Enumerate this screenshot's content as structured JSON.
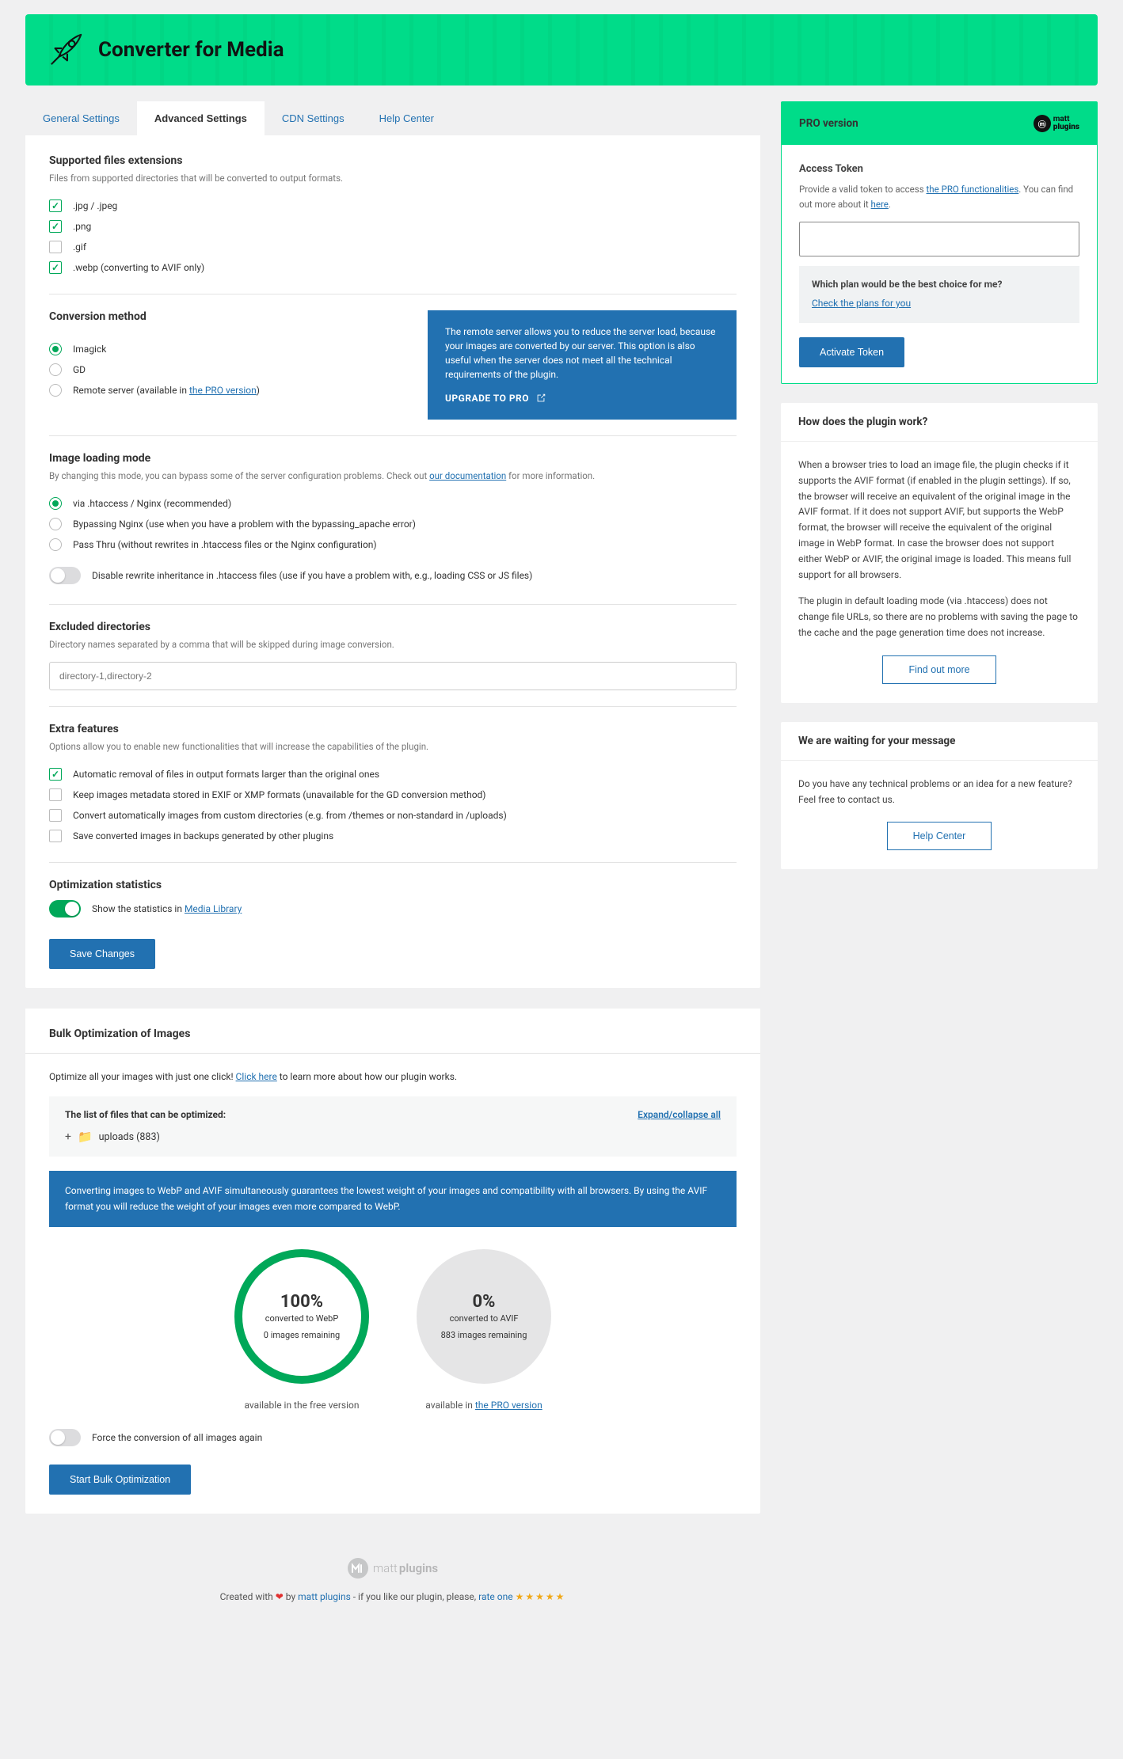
{
  "banner": {
    "title": "Converter for Media"
  },
  "tabs": [
    "General Settings",
    "Advanced Settings",
    "CDN Settings",
    "Help Center"
  ],
  "active_tab": 1,
  "supported": {
    "title": "Supported files extensions",
    "desc": "Files from supported directories that will be converted to output formats.",
    "items": [
      {
        "label": ".jpg / .jpeg",
        "checked": true
      },
      {
        "label": ".png",
        "checked": true
      },
      {
        "label": ".gif",
        "checked": false
      },
      {
        "label": ".webp (converting to AVIF only)",
        "checked": true
      }
    ]
  },
  "conversion": {
    "title": "Conversion method",
    "items": [
      {
        "label": "Imagick",
        "selected": true
      },
      {
        "label": "GD",
        "selected": false
      }
    ],
    "remote_prefix": "Remote server (available in ",
    "remote_link": "the PRO version",
    "remote_suffix": ")",
    "promo": "The remote server allows you to reduce the server load, because your images are converted by our server. This option is also useful when the server does not meet all the technical requirements of the plugin.",
    "promo_link": "UPGRADE TO PRO"
  },
  "loading": {
    "title": "Image loading mode",
    "desc_prefix": "By changing this mode, you can bypass some of the server configuration problems. Check out ",
    "desc_link": "our documentation",
    "desc_suffix": " for more information.",
    "items": [
      {
        "label": "via .htaccess / Nginx (recommended)",
        "selected": true
      },
      {
        "label": "Bypassing Nginx (use when you have a problem with the bypassing_apache error)",
        "selected": false
      },
      {
        "label": "Pass Thru (without rewrites in .htaccess files or the Nginx configuration)",
        "selected": false
      }
    ],
    "toggle_label": "Disable rewrite inheritance in .htaccess files (use if you have a problem with, e.g., loading CSS or JS files)",
    "toggle_on": false
  },
  "excluded": {
    "title": "Excluded directories",
    "desc": "Directory names separated by a comma that will be skipped during image conversion.",
    "placeholder": "directory-1,directory-2"
  },
  "extra": {
    "title": "Extra features",
    "desc": "Options allow you to enable new functionalities that will increase the capabilities of the plugin.",
    "items": [
      {
        "label": "Automatic removal of files in output formats larger than the original ones",
        "checked": true
      },
      {
        "label": "Keep images metadata stored in EXIF or XMP formats (unavailable for the GD conversion method)",
        "checked": false
      },
      {
        "label": "Convert automatically images from custom directories (e.g. from /themes or non-standard in /uploads)",
        "checked": false
      },
      {
        "label": "Save converted images in backups generated by other plugins",
        "checked": false
      }
    ]
  },
  "stats": {
    "title": "Optimization statistics",
    "label_prefix": "Show the statistics in ",
    "label_link": "Media Library",
    "on": true
  },
  "save_btn": "Save Changes",
  "bulk": {
    "title": "Bulk Optimization of Images",
    "desc_prefix": "Optimize all your images with just one click! ",
    "desc_link": "Click here",
    "desc_suffix": " to learn more about how our plugin works.",
    "tree_title": "The list of files that can be optimized:",
    "tree_expand": "Expand/collapse all",
    "tree_folder": "uploads (883)",
    "notice": "Converting images to WebP and AVIF simultaneously guarantees the lowest weight of your images and compatibility with all browsers. By using the AVIF format you will reduce the weight of your images even more compared to WebP.",
    "webp": {
      "pct": "100%",
      "label": "converted to WebP",
      "remaining": "0 images remaining",
      "avail": "available in the free version"
    },
    "avif": {
      "pct": "0%",
      "label": "converted to AVIF",
      "remaining": "883 images remaining",
      "avail_prefix": "available in ",
      "avail_link": "the PRO version"
    },
    "force_label": "Force the conversion of all images again",
    "force_on": false,
    "start_btn": "Start Bulk Optimization"
  },
  "footer": {
    "brand": "matt plugins",
    "credit_prefix": "Created with ",
    "credit_by": " by ",
    "credit_author": "matt plugins",
    "credit_mid": " - if you like our plugin, please, ",
    "rate": "rate one"
  },
  "pro": {
    "head": "PRO version",
    "brand": "matt plugins",
    "at_title": "Access Token",
    "at_desc_prefix": "Provide a valid token to access ",
    "at_desc_link": "the PRO functionalities",
    "at_desc_mid": ". You can find out more about it ",
    "at_desc_here": "here",
    "at_desc_suffix": ".",
    "plan_q": "Which plan would be the best choice for me?",
    "plan_link": "Check the plans for you",
    "activate": "Activate Token"
  },
  "how": {
    "title": "How does the plugin work?",
    "p1": "When a browser tries to load an image file, the plugin checks if it supports the AVIF format (if enabled in the plugin settings). If so, the browser will receive an equivalent of the original image in the AVIF format. If it does not support AVIF, but supports the WebP format, the browser will receive the equivalent of the original image in WebP format. In case the browser does not support either WebP or AVIF, the original image is loaded. This means full support for all browsers.",
    "p2": "The plugin in default loading mode (via .htaccess) does not change file URLs, so there are no problems with saving the page to the cache and the page generation time does not increase.",
    "btn": "Find out more"
  },
  "msg": {
    "title": "We are waiting for your message",
    "p": "Do you have any technical problems or an idea for a new feature? Feel free to contact us.",
    "btn": "Help Center"
  }
}
